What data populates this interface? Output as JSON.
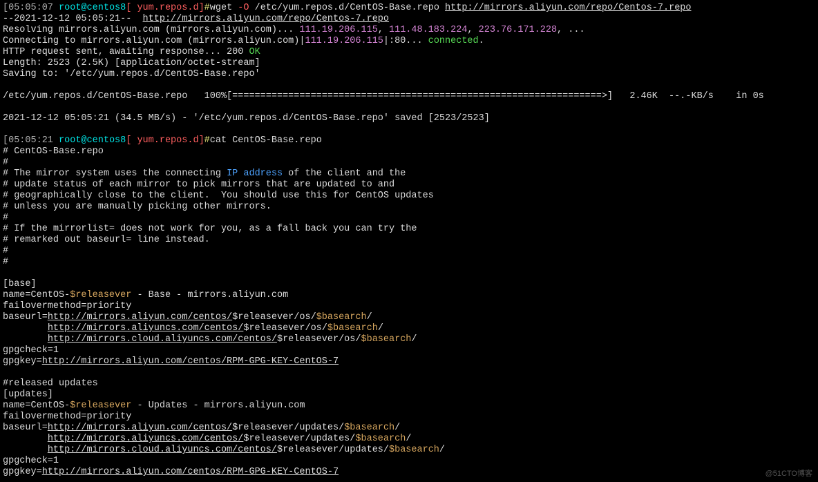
{
  "prompt1": {
    "time": "[05:05:07",
    "user_host": "root@centos8",
    "cwd": "[ yum.repos.d]",
    "hash": "#",
    "cmd_pre": "wget ",
    "flag": "-O",
    "arg_path": " /etc/yum.repos.d/CentOS-Base.repo ",
    "arg_url": "http://mirrors.aliyun.com/repo/Centos-7.repo"
  },
  "wget": {
    "l1a": "--2021-12-12 05:05:21--  ",
    "l1b": "http://mirrors.aliyun.com/repo/Centos-7.repo",
    "l2a": "Resolving mirrors.aliyun.com (mirrors.aliyun.com)... ",
    "ip1": "111.19.206.115",
    "sep": ", ",
    "ip2": "111.48.183.224",
    "ip3": "223.76.171.228",
    "l2z": ", ...",
    "l3a": "Connecting to mirrors.aliyun.com (mirrors.aliyun.com)|",
    "l3ip": "111.19.206.115",
    "l3b": "|:80... ",
    "l3ok": "connected",
    "dot": ".",
    "l4a": "HTTP request sent, awaiting response... 200 ",
    "l4ok": "OK",
    "l5": "Length: 2523 (2.5K) [application/octet-stream]",
    "l6": "Saving to: '/etc/yum.repos.d/CentOS-Base.repo'",
    "l7": "/etc/yum.repos.d/CentOS-Base.repo   100%[==================================================================>]   2.46K  --.-KB/s    in 0s",
    "l8": "2021-12-12 05:05:21 (34.5 MB/s) - '/etc/yum.repos.d/CentOS-Base.repo' saved [2523/2523]"
  },
  "prompt2": {
    "time": "[05:05:21",
    "user_host": "root@centos8",
    "cwd": "[ yum.repos.d]",
    "hash": "#",
    "cmd": "cat CentOS-Base.repo"
  },
  "repo": {
    "c0": "# CentOS-Base.repo",
    "c1": "#",
    "c2a": "# The mirror system uses the connecting ",
    "c2ip": "IP address",
    "c2b": " of the client and the",
    "c3": "# update status of each mirror to pick mirrors that are updated to and",
    "c4": "# geographically close to the client.  You should use this for CentOS updates",
    "c5": "# unless you are manually picking other mirrors.",
    "c6": "#",
    "c7": "# If the mirrorlist= does not work for you, as a fall back you can try the",
    "c8": "# remarked out baseurl= line instead.",
    "c9": "#",
    "c10": "#",
    "base_hdr": "[base]",
    "base_name_a": "name=CentOS-",
    "relv": "$releasever",
    "base_name_b": " - Base - mirrors.aliyun.com",
    "failover": "failovermethod=priority",
    "baseurl_key": "baseurl=",
    "u1": "http://mirrors.aliyun.com/centos/",
    "u2": "http://mirrors.aliyuncs.com/centos/",
    "u3": "http://mirrors.cloud.aliyuncs.com/centos/",
    "os_path": "$releasever/os/",
    "basearch": "$basearch",
    "slash": "/",
    "indent": "        ",
    "gpgcheck": "gpgcheck=1",
    "gpgkey_key": "gpgkey=",
    "gpgkey_url": "http://mirrors.aliyun.com/centos/RPM-GPG-KEY-CentOS-7",
    "rel_comment": "#released updates",
    "upd_hdr": "[updates]",
    "upd_name_b": " - Updates - mirrors.aliyun.com",
    "upd_path": "$releasever/updates/"
  },
  "watermark": "@51CTO博客"
}
